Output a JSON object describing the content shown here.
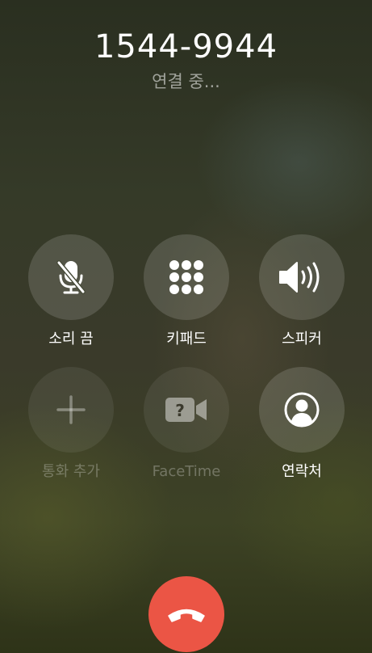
{
  "call": {
    "number": "1544-9944",
    "status": "연결 중..."
  },
  "buttons": [
    {
      "label": "소리 끔",
      "icon": "mic-off-icon",
      "enabled": true
    },
    {
      "label": "키패드",
      "icon": "keypad-icon",
      "enabled": true
    },
    {
      "label": "스피커",
      "icon": "speaker-icon",
      "enabled": true
    },
    {
      "label": "통화 추가",
      "icon": "plus-icon",
      "enabled": false
    },
    {
      "label": "FaceTime",
      "icon": "facetime-icon",
      "enabled": false
    },
    {
      "label": "연락처",
      "icon": "contact-icon",
      "enabled": true
    }
  ],
  "end_call": {
    "icon": "hang-up-icon",
    "color": "#eb5545"
  }
}
